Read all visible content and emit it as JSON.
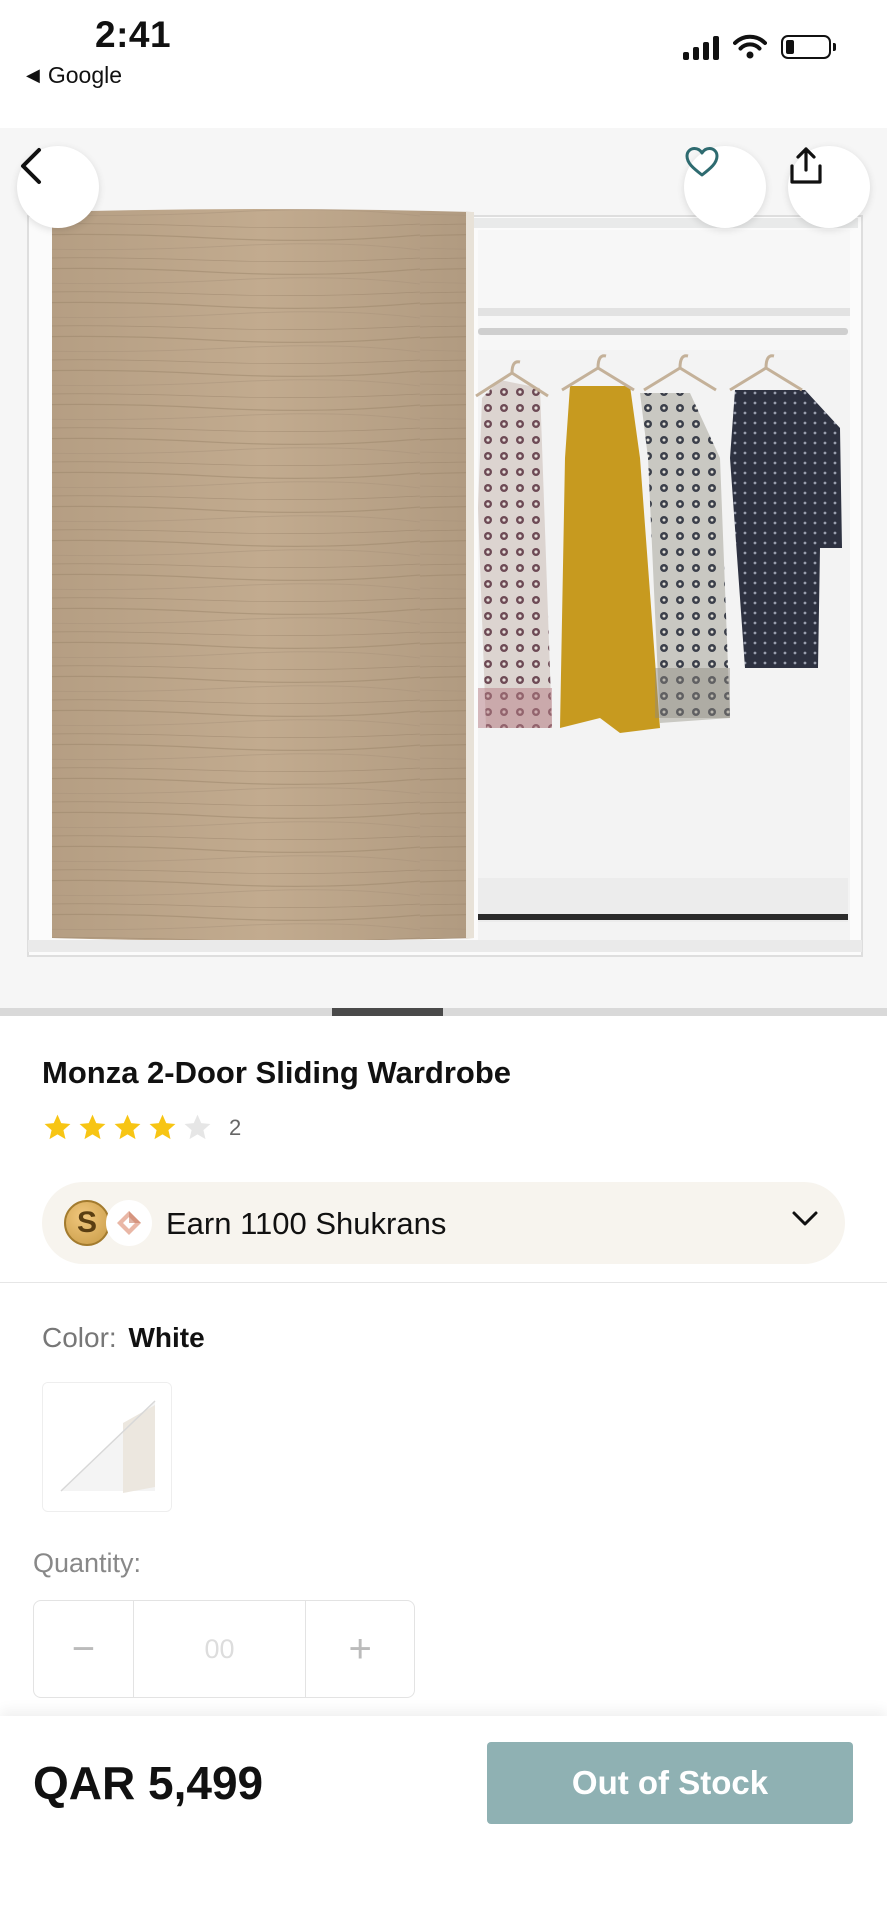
{
  "status_bar": {
    "time": "2:41",
    "back_app": "Google",
    "back_arrow": "◀"
  },
  "gallery": {
    "active_index": 2,
    "icons": {
      "back": "chevron-left-icon",
      "favorite": "heart-icon",
      "share": "share-icon"
    }
  },
  "product": {
    "title": "Monza 2-Door Sliding Wardrobe",
    "rating": 4,
    "rating_max": 5,
    "review_count": "2"
  },
  "shukran": {
    "coin_letter": "S",
    "label": "Earn 1100 Shukrans"
  },
  "color": {
    "label": "Color:",
    "value": "White"
  },
  "quantity": {
    "label": "Quantity:",
    "minus": "−",
    "value": "00",
    "plus": "+"
  },
  "purchase": {
    "price": "QAR 5,499",
    "button": "Out of Stock"
  },
  "colors": {
    "star_filled": "#F7C514",
    "star_empty": "#E6E6E6",
    "button_disabled": "#8FB1B3",
    "shukran_bg": "#F7F4EE",
    "heart": "#2E6B70"
  }
}
